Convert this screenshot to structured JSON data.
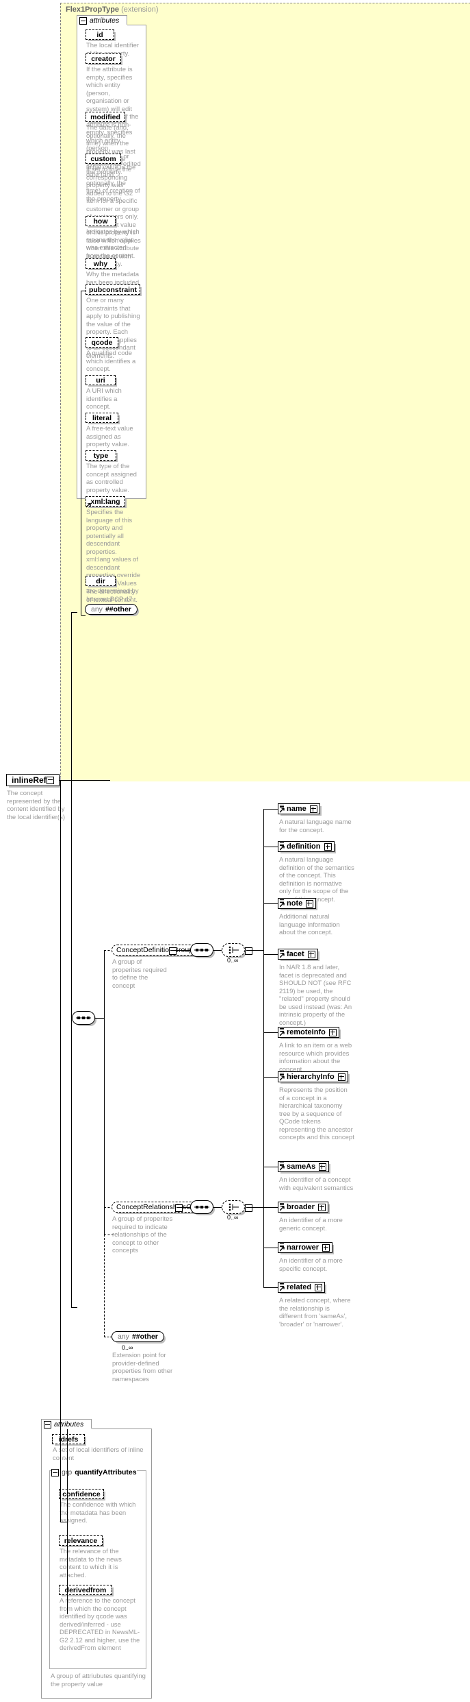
{
  "diagram": {
    "kind": "xsd-documentation-diagram",
    "root_element": {
      "name": "inlineRef",
      "doc": "The concept represented by the content identified by the local identifier(s)"
    },
    "extension": {
      "title": "Flex1PropType",
      "subtitle": "(extension)"
    },
    "attributes_label": "attributes",
    "top_attributes": [
      {
        "name": "id",
        "doc": "The local identifier of the property."
      },
      {
        "name": "creator",
        "doc": "If the attribute is empty, specifies which entity (person, organisation or system) will edit the property. If the attribute is non-empty, specifies which entity (person, organisation or system) has edited the property."
      },
      {
        "name": "modified",
        "doc": "The date (and, optionally, the time) when the property was last modified. The initial value is the date (and, optionally, the time) of creation of the property."
      },
      {
        "name": "custom",
        "doc": "If set to true the corresponding property was added to the G2 Item for a specific customer or group of customers only. The default value of this property is false which applies when this attribute is not used with the property."
      },
      {
        "name": "how",
        "doc": "Indicates by which means the value was extracted from the content."
      },
      {
        "name": "why",
        "doc": "Why the metadata has been included."
      },
      {
        "name": "pubconstraint",
        "doc": "One or many constraints that apply to publishing the value of the property. Each constraint applies to all descendant elements."
      },
      {
        "name": "qcode",
        "doc": "A qualified code which identifies a concept."
      },
      {
        "name": "uri",
        "doc": "A URI which identifies a concept."
      },
      {
        "name": "literal",
        "doc": "A free-text value assigned as property value."
      },
      {
        "name": "type",
        "doc": "The type of the concept assigned as controlled property value."
      },
      {
        "name": "xml:lang",
        "doc": "Specifies the language of this property and potentially all descendant properties. xml:lang values of descendant properties override this value. Values are determined by Internet BCP 47."
      },
      {
        "name": "dir",
        "doc": "The directionality of textual content."
      }
    ],
    "top_any": {
      "any": "any",
      "other": "##other"
    },
    "groups": [
      {
        "name": "ConceptDefinitionGroup",
        "doc": "A group of properites required to define the concept",
        "occurs": "0..∞",
        "children": [
          {
            "name": "name",
            "doc": "A natural language name for the concept."
          },
          {
            "name": "definition",
            "doc": "A natural language definition of the semantics of the concept. This definition is normative only for the scope of the use of this concept."
          },
          {
            "name": "note",
            "doc": "Additional natural language information about the concept."
          },
          {
            "name": "facet",
            "doc": "In NAR 1.8 and later, facet is deprecated and SHOULD NOT (see RFC 2119) be used, the \"related\" property should be used instead (was: An intrinsic property of the concept.)"
          },
          {
            "name": "remoteInfo",
            "doc": "A link to an item or a web resource which provides information about the concept"
          },
          {
            "name": "hierarchyInfo",
            "doc": "Represents the position of a concept in a hierarchical taxonomy tree by a sequence of QCode tokens representing the ancestor concepts and this concept"
          }
        ]
      },
      {
        "name": "ConceptRelationshipsGroup",
        "doc": "A group of properites required to indicate relationships of the concept to other concepts",
        "occurs": "0..∞",
        "children": [
          {
            "name": "sameAs",
            "doc": "An identifier of a concept with equivalent semantics"
          },
          {
            "name": "broader",
            "doc": "An identifier of a more generic concept."
          },
          {
            "name": "narrower",
            "doc": "An identifier of a more specific concept."
          },
          {
            "name": "related",
            "doc": "A related concept, where the relationship is different from 'sameAs', 'broader' or 'narrower'."
          }
        ]
      }
    ],
    "middle_any": {
      "any": "any",
      "other": "##other",
      "occurs": "0..∞",
      "doc": "Extension point for provider-defined properties from other namespaces"
    },
    "bottom_attributes": [
      {
        "name": "idrefs",
        "doc": "A set of local identifiers of inline content"
      }
    ],
    "quantify_group": {
      "keyword": "grp",
      "name": "quantifyAttributes",
      "doc": "A group of attriubutes quantifying the property value",
      "attributes": [
        {
          "name": "confidence",
          "doc": "The confidence with which the metadata has been assigned."
        },
        {
          "name": "relevance",
          "doc": "The relevance of the metadata to the news content to which it is attached."
        },
        {
          "name": "derivedfrom",
          "doc": "A reference to the concept from which the concept identified by qcode was derived/inferred - use DEPRECATED in NewsML-G2 2.12 and higher, use the derivedFrom element"
        }
      ]
    },
    "colors": {
      "panel_bg": "#ffffcc",
      "doc_text": "#9a9a9a",
      "title_text": "#666666",
      "line": "#000000",
      "shadow": "#bdbdbd"
    }
  }
}
